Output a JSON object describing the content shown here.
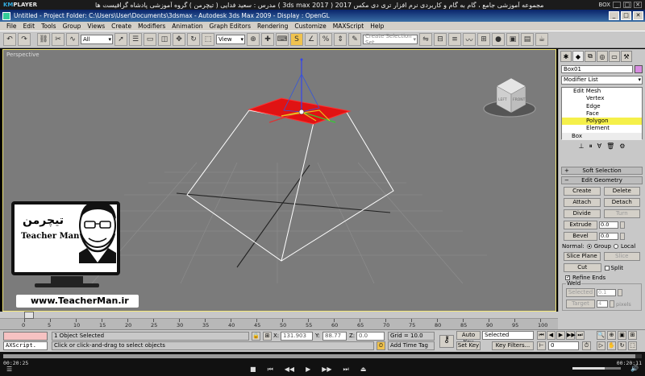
{
  "player": {
    "logo_prefix": "KM",
    "logo_suffix": "PLAYER",
    "title": "مجموعه آموزشی جامع ، گام به گام و کاربردی نرم افزار تری دی مکس 2017   ( 3ds max 2017 )   مدرس : سعید فدایی ( تیچرمن ) گروه آموزشی پادشاه گرافیست ها",
    "box_label": "BOX",
    "elapsed": "00:20:25",
    "total": "00:20:11",
    "progress": 0.99,
    "volume": 0.67
  },
  "window": {
    "title": "Untitled    - Project Folder: C:\\Users\\User\\Documents\\3dsmax    - Autodesk 3ds Max  2009    - Display : OpenGL"
  },
  "menu": [
    "File",
    "Edit",
    "Tools",
    "Group",
    "Views",
    "Create",
    "Modifiers",
    "Animation",
    "Graph Editors",
    "Rendering",
    "Customize",
    "MAXScript",
    "Help"
  ],
  "toolbar": {
    "selection_filter": "All",
    "ref_coord": "View",
    "named_selection_placeholder": "Create Selection Set"
  },
  "viewport": {
    "label": "Perspective",
    "cube_labels": [
      "LEFT",
      "FRONT"
    ]
  },
  "command_panel": {
    "object_name": "Box01",
    "object_color": "#d88ce0",
    "modifier_list": "Modifier List",
    "stack": {
      "root": "Edit Mesh",
      "subs": [
        "Vertex",
        "Edge",
        "Face",
        "Polygon",
        "Element"
      ],
      "selected": "Polygon",
      "base": "Box"
    },
    "rollouts": {
      "soft_selection": "Soft Selection",
      "edit_geometry": "Edit Geometry"
    },
    "buttons": {
      "create": "Create",
      "delete": "Delete",
      "attach": "Attach",
      "detach": "Detach",
      "divide": "Divide",
      "turn": "Turn",
      "extrude": "Extrude",
      "extrude_val": "0.0",
      "bevel": "Bevel",
      "bevel_val": "0.0",
      "normal": "Normal:",
      "group": "Group",
      "local": "Local",
      "slice_plane": "Slice Plane",
      "slice": "Slice",
      "cut": "Cut",
      "split": "Split",
      "refine_ends": "Refine Ends",
      "weld": "Weld",
      "selected": "Selected",
      "selected_val": "0.1",
      "target": "Target",
      "target_val": "4",
      "pixels": "pixels"
    }
  },
  "timeline": {
    "slider": "0 / 100",
    "ticks": [
      "0",
      "5",
      "10",
      "15",
      "20",
      "25",
      "30",
      "35",
      "40",
      "45",
      "50",
      "55",
      "60",
      "65",
      "70",
      "75",
      "80",
      "85",
      "90",
      "95",
      "100"
    ]
  },
  "status": {
    "maxscript": "AXScript.",
    "selection": "1 Object Selected",
    "prompt": "Click or click-and-drag to select objects",
    "x_label": "X:",
    "x_val": "131.903",
    "y_label": "Y:",
    "y_val": "88.77",
    "z_label": "Z:",
    "z_val": "0.0",
    "grid": "Grid = 10.0",
    "add_time_tag": "Add Time Tag",
    "auto_key": "Auto Key",
    "set_key": "Set Key",
    "key_mode": "Selected",
    "key_filters": "Key Filters...",
    "frame": "0"
  },
  "overlay": {
    "brand_fa": "تیچرمن",
    "brand_en": "Teacher Man",
    "site": "www.TeacherMan.ir"
  }
}
